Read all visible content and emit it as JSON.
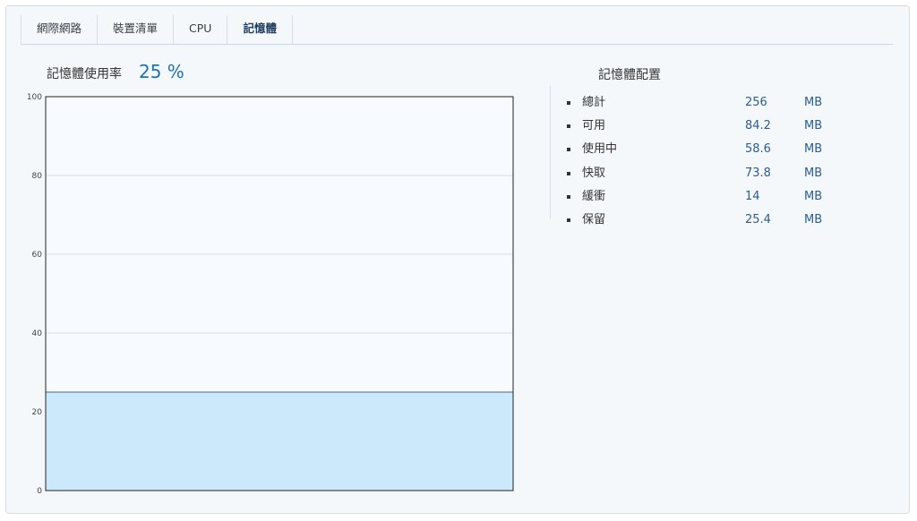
{
  "tabs": [
    {
      "label": "網際網路",
      "active": false
    },
    {
      "label": "裝置清單",
      "active": false
    },
    {
      "label": "CPU",
      "active": false
    },
    {
      "label": "記憶體",
      "active": true
    }
  ],
  "usage": {
    "label": "記憶體使用率",
    "value": "25 %"
  },
  "config": {
    "title": "記憶體配置",
    "items": [
      {
        "label": "總計",
        "value": "256",
        "unit": "MB"
      },
      {
        "label": "可用",
        "value": "84.2",
        "unit": "MB"
      },
      {
        "label": "使用中",
        "value": "58.6",
        "unit": "MB"
      },
      {
        "label": "快取",
        "value": "73.8",
        "unit": "MB"
      },
      {
        "label": "緩衝",
        "value": "14",
        "unit": "MB"
      },
      {
        "label": "保留",
        "value": "25.4",
        "unit": "MB"
      }
    ]
  },
  "chart_data": {
    "type": "area",
    "title": "",
    "xlabel": "",
    "ylabel": "",
    "ylim": [
      0,
      100
    ],
    "yticks": [
      "0",
      "20",
      "40",
      "60",
      "80",
      "100"
    ],
    "grid": true,
    "series": [
      {
        "values": [
          25,
          25
        ]
      }
    ]
  },
  "colors": {
    "accent": "#1a73b8",
    "fill": "#cce8fb",
    "line": "#4a6a82",
    "grid": "#d6dfe8"
  }
}
